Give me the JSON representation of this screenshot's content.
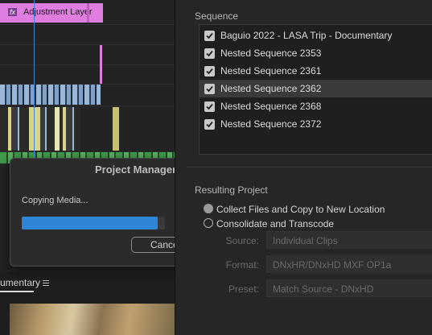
{
  "timeline": {
    "adjustment_clip_label": "Adjustment Layer",
    "fx_badge": "fx"
  },
  "dialog": {
    "title": "Project Manager",
    "status": "Copying Media...",
    "progress": 0.95,
    "cancel_label": "Cancel"
  },
  "bottom_panel": {
    "tab_label": "umentary",
    "menu_icon": "hamburger-icon"
  },
  "sequence_section": {
    "title": "Sequence",
    "items": [
      {
        "label": "Baguio 2022 - LASA Trip - Documentary",
        "checked": true
      },
      {
        "label": "Nested Sequence 2353",
        "checked": true
      },
      {
        "label": "Nested Sequence 2361",
        "checked": true
      },
      {
        "label": "Nested Sequence 2362",
        "checked": true,
        "highlighted": true
      },
      {
        "label": "Nested Sequence 2368",
        "checked": true
      },
      {
        "label": "Nested Sequence 2372",
        "checked": true
      }
    ]
  },
  "resulting_project": {
    "title": "Resulting Project",
    "options": [
      {
        "label": "Collect Files and Copy to New Location",
        "selected": true
      },
      {
        "label": "Consolidate and Transcode",
        "selected": false
      }
    ],
    "source_label": "Source:",
    "source_value": "Individual Clips",
    "format_label": "Format:",
    "format_value": "DNxHR/DNxHD MXF OP1a",
    "preset_label": "Preset:",
    "preset_value": "Match Source - DNxHD"
  },
  "colors": {
    "adjustment_clip": "#e07de0",
    "playhead": "#3a86d6",
    "progress": "#2f86d9",
    "video_clip_blue": "#9ab7d8",
    "video_clip_yellow": "#d8d48a",
    "video_clip_green": "#3f9a4a"
  }
}
